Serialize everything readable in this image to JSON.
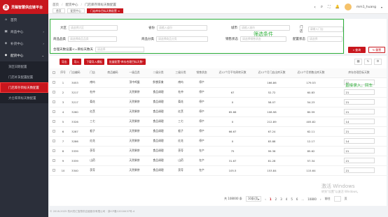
{
  "app": {
    "logo_text": "灵稿智慧供应链平台",
    "logo_mark": "灵"
  },
  "sidebar": {
    "items": [
      {
        "label": "首页",
        "icon": "home-icon",
        "glyph": "⌂"
      },
      {
        "label": "商品中心",
        "icon": "box-icon",
        "glyph": "▣",
        "arrow": "›"
      },
      {
        "label": "补货中心",
        "icon": "cart-icon",
        "glyph": "◈",
        "arrow": "›"
      },
      {
        "label": "配货中心",
        "icon": "truck-icon",
        "glyph": "◆",
        "arrow": "⌄"
      }
    ],
    "subitems": [
      {
        "label": "货区日期配置"
      },
      {
        "label": "门店补货配置配置"
      },
      {
        "label": "门店库存目标天数配置",
        "active": true
      },
      {
        "label": "大仓库目标天数配置"
      }
    ]
  },
  "header": {
    "breadcrumb": [
      "首页",
      "配货中心",
      "门店库存目标天数配置"
    ],
    "tabs": [
      {
        "label": "首页"
      },
      {
        "label": "配货中心"
      },
      {
        "label": "门店库存目标天数配置"
      }
    ],
    "active_tab": "门店库存目标天数配置 ×",
    "user": "mm1_huang",
    "icons": {
      "back": "‹",
      "search": "⌕",
      "fullscreen": "⛶",
      "bell": "🔔",
      "caret": "▾"
    }
  },
  "filter": {
    "annotation": "筛选条件",
    "fields": [
      {
        "label": "大区",
        "placeholder": "请选择大区"
      },
      {
        "label": "省份",
        "placeholder": "请输入省份"
      },
      {
        "label": "城市",
        "placeholder": "请输入城市"
      },
      {
        "label": "门店",
        "placeholder": "请输入门店"
      },
      {
        "label": "商品品类",
        "placeholder": "请选择商品品类"
      },
      {
        "label": "商品分类",
        "placeholder": "请选择商品分类"
      },
      {
        "label": "销售状态",
        "placeholder": "请选择销售状态"
      },
      {
        "label": "配置状态",
        "placeholder": "请选择"
      },
      {
        "label": "合理天数设置<=目标天数天",
        "placeholder": "请选择"
      }
    ],
    "search_label": "查询",
    "reset_label": "重置"
  },
  "toolbar": {
    "buttons": [
      "导出",
      "导入",
      "下载导入模板",
      "批量配置\"库存合理目标天数\""
    ],
    "tool_icons": [
      {
        "name": "column-icon",
        "glyph": "▦"
      },
      {
        "name": "refresh-icon",
        "glyph": "↻"
      },
      {
        "name": "settings-icon",
        "glyph": "⚙"
      }
    ]
  },
  "table": {
    "columns": [
      "序号",
      "门店编码",
      "门店",
      "商品编码",
      "一级品类",
      "二级分类",
      "三级分类",
      "销售状态",
      "近12个月平均周转天数",
      "近12个月门店出库天数",
      "近12个月销售出库天数",
      "库存合理目标天数"
    ],
    "rows": [
      [
        "1",
        "3053",
        "南屿",
        "",
        "顶中鸡蛋",
        "鲜食家禽",
        "南屿",
        "停产",
        "",
        "166.86",
        "179.53",
        "21"
      ],
      [
        "2",
        "3217",
        "杜仲",
        "",
        "天然果饼",
        "食品调理",
        "杜仲",
        "停产",
        "67",
        "52.72",
        "60.83",
        "21"
      ],
      [
        "3",
        "3217",
        "菊花",
        "",
        "天然果饼",
        "食品调理",
        "菊花",
        "停产",
        "0",
        "58.07",
        "54.23",
        "21"
      ],
      [
        "4",
        "3260",
        "红芪",
        "",
        "天然果饼",
        "食品调理",
        "红芪",
        "停产",
        "65.66",
        "108.98",
        "80.59",
        "21"
      ],
      [
        "5",
        "3326",
        "三七",
        "",
        "天然果饼",
        "食品调理",
        "三七",
        "停产",
        "0",
        "212.89",
        "405.82",
        "14"
      ],
      [
        "6",
        "3287",
        "栀子",
        "",
        "天然果饼",
        "食品调理",
        "栀子",
        "停产",
        "66.67",
        "67.24",
        "62.11",
        "21"
      ],
      [
        "7",
        "3286",
        "红花",
        "",
        "天然果饼",
        "食品调理",
        "红花",
        "停产",
        "0",
        "83.88",
        "12.17",
        "14"
      ],
      [
        "8",
        "3339",
        "茯苓",
        "",
        "天然果饼",
        "食品调理",
        "茯苓",
        "在产",
        "75",
        "99.36",
        "85.62",
        "21"
      ],
      [
        "9",
        "3339",
        "山药",
        "",
        "天然果饼",
        "食品调理",
        "山药",
        "在产",
        "31.67",
        "81.28",
        "57.34",
        "21"
      ],
      [
        "10",
        "3340",
        "茯苓",
        "",
        "天然果饼",
        "食品调理",
        "茯苓",
        "在产",
        "105.5",
        "153.84",
        "115.64",
        "21"
      ]
    ],
    "annotation": "直接录入，回车"
  },
  "pager": {
    "total": "共 108000 条",
    "page_size": "10条/页",
    "pages": [
      "1",
      "2",
      "3",
      "4",
      "5",
      "6",
      "...",
      "10800"
    ],
    "prev": "‹",
    "next": "›",
    "goto_label": "前往",
    "page_unit": "页"
  },
  "footer": {
    "text": "© 2018-2025 杭州灵汇智慧供应链股份有限公司 · 浙ICP备12018437号-4"
  },
  "watermark": {
    "line1": "激活 Windows",
    "line2": "转到\"设置\"以激活 Windows。"
  }
}
